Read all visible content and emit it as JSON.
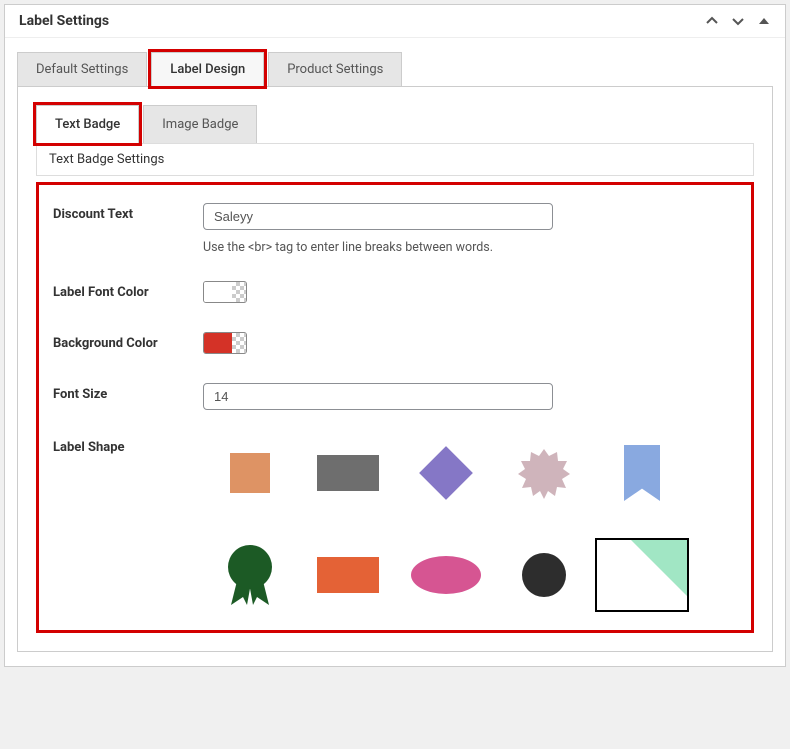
{
  "panel": {
    "title": "Label Settings"
  },
  "tabs": {
    "main": [
      {
        "label": "Default Settings"
      },
      {
        "label": "Label Design"
      },
      {
        "label": "Product Settings"
      }
    ],
    "inner": [
      {
        "label": "Text Badge"
      },
      {
        "label": "Image Badge"
      }
    ]
  },
  "section": {
    "title": "Text Badge Settings"
  },
  "form": {
    "discountText": {
      "label": "Discount Text",
      "value": "Saleyy",
      "help": "Use the <br> tag to enter line breaks between words."
    },
    "labelFontColor": {
      "label": "Label Font Color",
      "value": "#ffffff"
    },
    "backgroundColor": {
      "label": "Background Color",
      "value": "#d43227"
    },
    "fontSize": {
      "label": "Font Size",
      "value": "14"
    },
    "labelShape": {
      "label": "Label Shape"
    }
  },
  "shapes": [
    "square",
    "rectangle",
    "diamond",
    "starburst",
    "ribbon",
    "seal",
    "rectangle-2",
    "ellipse",
    "circle",
    "triangle"
  ]
}
